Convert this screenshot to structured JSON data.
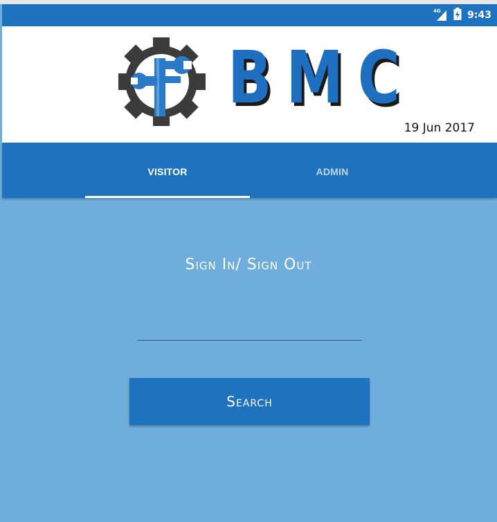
{
  "status_bar": {
    "network": "4G",
    "time": "9:43",
    "icons": [
      "signal-icon",
      "battery-charging-icon"
    ]
  },
  "header": {
    "logo_text": "BMC",
    "logo_icon": "gear-wrench-icon",
    "date": "19 Jun 2017"
  },
  "tabs": [
    {
      "label": "VISITOR",
      "active": true
    },
    {
      "label": "ADMIN",
      "active": false
    }
  ],
  "main": {
    "heading": "Sign In/ Sign Out",
    "input_value": "",
    "search_button": "Search"
  },
  "colors": {
    "primary": "#1f72bd",
    "background": "#6faedc",
    "header_background": "#ffffff"
  }
}
